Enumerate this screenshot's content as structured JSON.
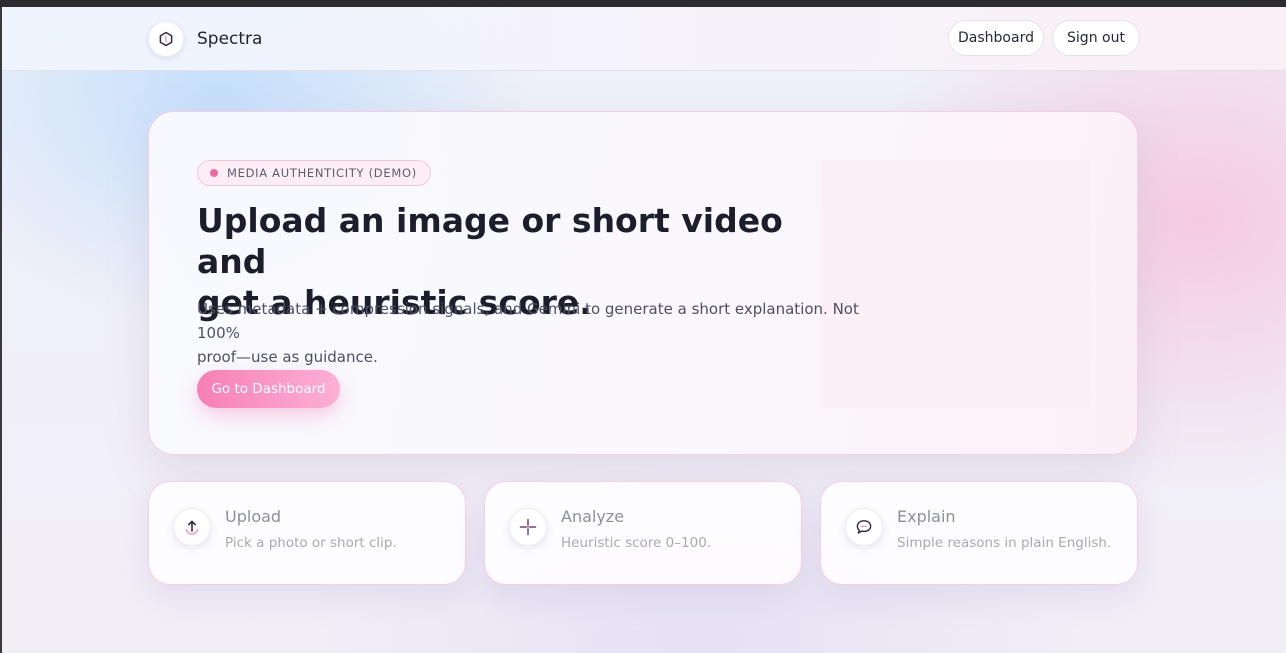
{
  "header": {
    "brand_name": "Spectra",
    "logo_icon": "hexagon-icon",
    "nav": {
      "dashboard_label": "Dashboard",
      "signout_label": "Sign out"
    }
  },
  "hero": {
    "badge": "MEDIA AUTHENTICITY (DEMO)",
    "title_line1": "Upload an image or short video and",
    "title_line2": "get a heuristic score.",
    "description_line1": "Uses metadata + compression signals, and Gemini to generate a short explanation. Not 100%",
    "description_line2": "proof—use as guidance.",
    "cta_label": "Go to Dashboard"
  },
  "features": [
    {
      "title": "Upload",
      "subtitle": "Pick a photo or short clip.",
      "icon": "upload-arrow-icon"
    },
    {
      "title": "Analyze",
      "subtitle": "Heuristic score 0–100.",
      "icon": "sparkle-icon"
    },
    {
      "title": "Explain",
      "subtitle": "Simple reasons in plain English.",
      "icon": "chat-bubble-icon"
    }
  ],
  "colors": {
    "accent": "#f77fb6",
    "accent_light": "#fcb0d6",
    "badge_dot": "#ee6aa7",
    "card_border": "#f3cfe2"
  }
}
